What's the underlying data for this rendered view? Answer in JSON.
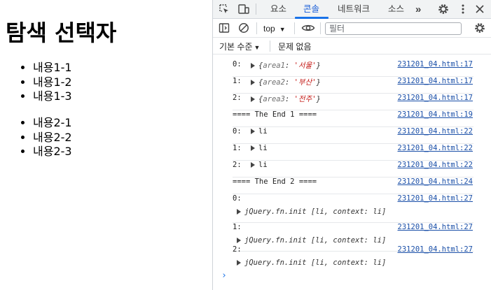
{
  "page": {
    "title": "탐색 선택자",
    "list1": [
      "내용1-1",
      "내용1-2",
      "내용1-3"
    ],
    "list2": [
      "내용2-1",
      "내용2-2",
      "내용2-3"
    ]
  },
  "devtools": {
    "tabs": [
      "요소",
      "콘솔",
      "네트워크",
      "소스"
    ],
    "active_tab": "콘솔",
    "more_tabs": "»",
    "context": "top",
    "filter_placeholder": "필터",
    "levels_label": "기본 수준",
    "issues_label": "문제 없음",
    "accent_color": "#1a73e8",
    "console_messages": [
      {
        "prefix": "0: ",
        "key": "area1",
        "value": "'서울'",
        "source": "231201_04.html:17"
      },
      {
        "prefix": "1: ",
        "key": "area2",
        "value": "'부산'",
        "source": "231201_04.html:17"
      },
      {
        "prefix": "2: ",
        "key": "area3",
        "value": "'전주'",
        "source": "231201_04.html:17"
      },
      {
        "text": "==== The End 1 ====",
        "source": "231201_04.html:19"
      },
      {
        "prefix": "0: ",
        "text": "li",
        "source": "231201_04.html:22"
      },
      {
        "prefix": "1: ",
        "text": "li",
        "source": "231201_04.html:22"
      },
      {
        "prefix": "2: ",
        "text": "li",
        "source": "231201_04.html:22"
      },
      {
        "text": "==== The End 2 ====",
        "source": "231201_04.html:24"
      },
      {
        "text": "0:",
        "detail": "jQuery.fn.init [li, context: li]",
        "source": "231201_04.html:27"
      },
      {
        "text": "1:",
        "detail": "jQuery.fn.init [li, context: li]",
        "source": "231201_04.html:27"
      },
      {
        "text": "2:",
        "detail": "jQuery.fn.init [li, context: li]",
        "source": "231201_04.html:27"
      }
    ],
    "prompt": "›"
  }
}
